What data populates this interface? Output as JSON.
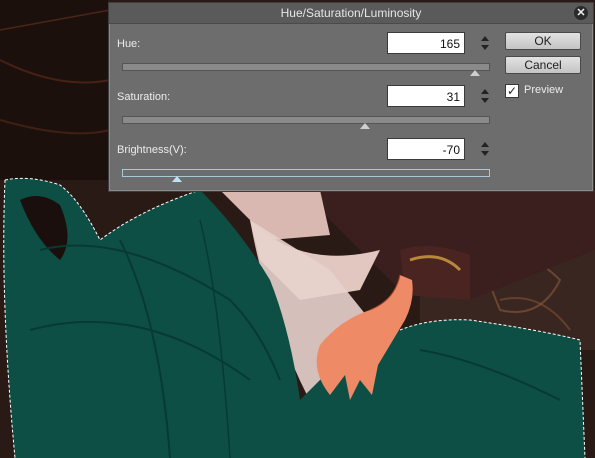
{
  "dialog": {
    "title": "Hue/Saturation/Luminosity",
    "close_icon": "close-icon",
    "fields": [
      {
        "label": "Hue:",
        "value": "165",
        "slider_fraction": 0.96
      },
      {
        "label": "Saturation:",
        "value": "31",
        "slider_fraction": 0.66
      },
      {
        "label": "Brightness(V):",
        "value": "-70",
        "slider_fraction": 0.15
      }
    ],
    "ok_label": "OK",
    "cancel_label": "Cancel",
    "preview_label": "Preview",
    "preview_checked": true
  },
  "colors": {
    "dialog_bg": "#6d6d6d",
    "active_track": "#a9c9d8",
    "dress_teal": "#0e4f45",
    "skin": "#ef8a66"
  }
}
